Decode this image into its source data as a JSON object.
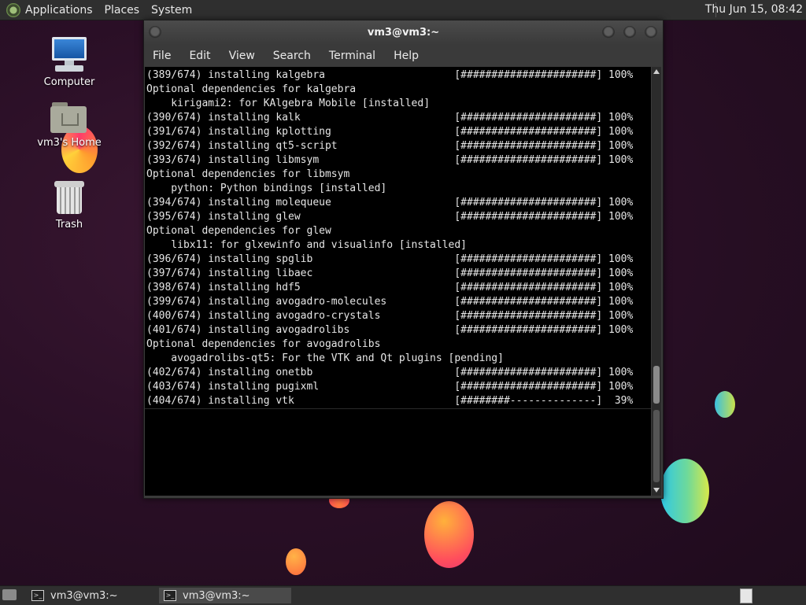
{
  "top_panel": {
    "menus": [
      "Applications",
      "Places",
      "System"
    ],
    "clock": "Thu Jun 15, 08:42"
  },
  "desktop_icons": [
    {
      "label": "Computer",
      "icon": "computer-icon"
    },
    {
      "label": "vm3's Home",
      "icon": "home-folder-icon"
    },
    {
      "label": "Trash",
      "icon": "trash-icon"
    }
  ],
  "window": {
    "title": "vm3@vm3:~",
    "menu": [
      "File",
      "Edit",
      "View",
      "Search",
      "Terminal",
      "Help"
    ]
  },
  "terminal": {
    "lines": [
      "(389/674) installing kalgebra                     [######################] 100%",
      "Optional dependencies for kalgebra",
      "    kirigami2: for KAlgebra Mobile [installed]",
      "(390/674) installing kalk                         [######################] 100%",
      "(391/674) installing kplotting                    [######################] 100%",
      "(392/674) installing qt5-script                   [######################] 100%",
      "(393/674) installing libmsym                      [######################] 100%",
      "Optional dependencies for libmsym",
      "    python: Python bindings [installed]",
      "(394/674) installing molequeue                    [######################] 100%",
      "(395/674) installing glew                         [######################] 100%",
      "Optional dependencies for glew",
      "    libx11: for glxewinfo and visualinfo [installed]",
      "(396/674) installing spglib                       [######################] 100%",
      "(397/674) installing libaec                       [######################] 100%",
      "(398/674) installing hdf5                         [######################] 100%",
      "(399/674) installing avogadro-molecules           [######################] 100%",
      "(400/674) installing avogadro-crystals            [######################] 100%",
      "(401/674) installing avogadrolibs                 [######################] 100%",
      "Optional dependencies for avogadrolibs",
      "    avogadrolibs-qt5: For the VTK and Qt plugins [pending]",
      "(402/674) installing onetbb                       [######################] 100%",
      "(403/674) installing pugixml                      [######################] 100%",
      "(404/674) installing vtk                          [########--------------]  39%"
    ]
  },
  "taskbar": {
    "tasks": [
      {
        "label": "vm3@vm3:~",
        "active": false
      },
      {
        "label": "vm3@vm3:~",
        "active": true
      }
    ]
  }
}
